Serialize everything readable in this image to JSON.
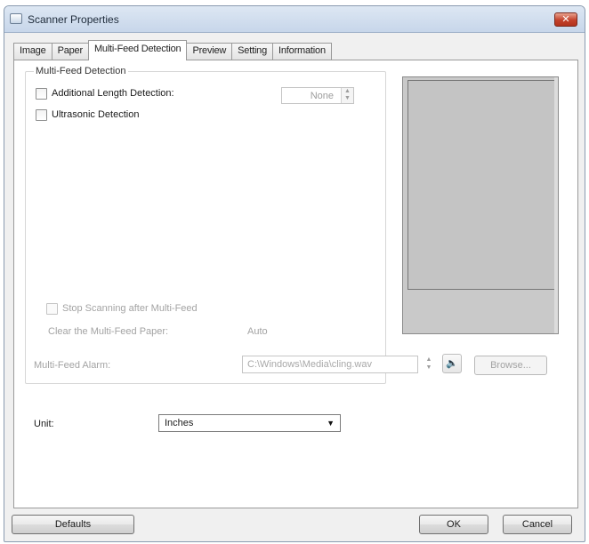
{
  "window": {
    "title": "Scanner Properties",
    "close_glyph": "✕",
    "icon": "scanner-icon"
  },
  "tabs": [
    {
      "label": "Image"
    },
    {
      "label": "Paper"
    },
    {
      "label": "Multi-Feed Detection",
      "active": true
    },
    {
      "label": "Preview"
    },
    {
      "label": "Setting"
    },
    {
      "label": "Information"
    }
  ],
  "multifeed": {
    "group_title": "Multi-Feed Detection",
    "additional_length_label": "Additional Length Detection:",
    "additional_length_value": "None",
    "ultrasonic_label": "Ultrasonic Detection",
    "stop_scanning_label": "Stop Scanning after Multi-Feed",
    "clear_paper_label": "Clear the Multi-Feed Paper:",
    "clear_paper_value": "Auto",
    "alarm_label": "Multi-Feed Alarm:",
    "alarm_path": "C:\\Windows\\Media\\cling.wav",
    "browse_label": "Browse..."
  },
  "unit": {
    "label": "Unit:",
    "value": "Inches"
  },
  "footer": {
    "defaults_label": "Defaults",
    "ok_label": "OK",
    "cancel_label": "Cancel"
  },
  "colors": {
    "close_button": "#c3412b",
    "preview_fill": "#c4c4c4"
  }
}
